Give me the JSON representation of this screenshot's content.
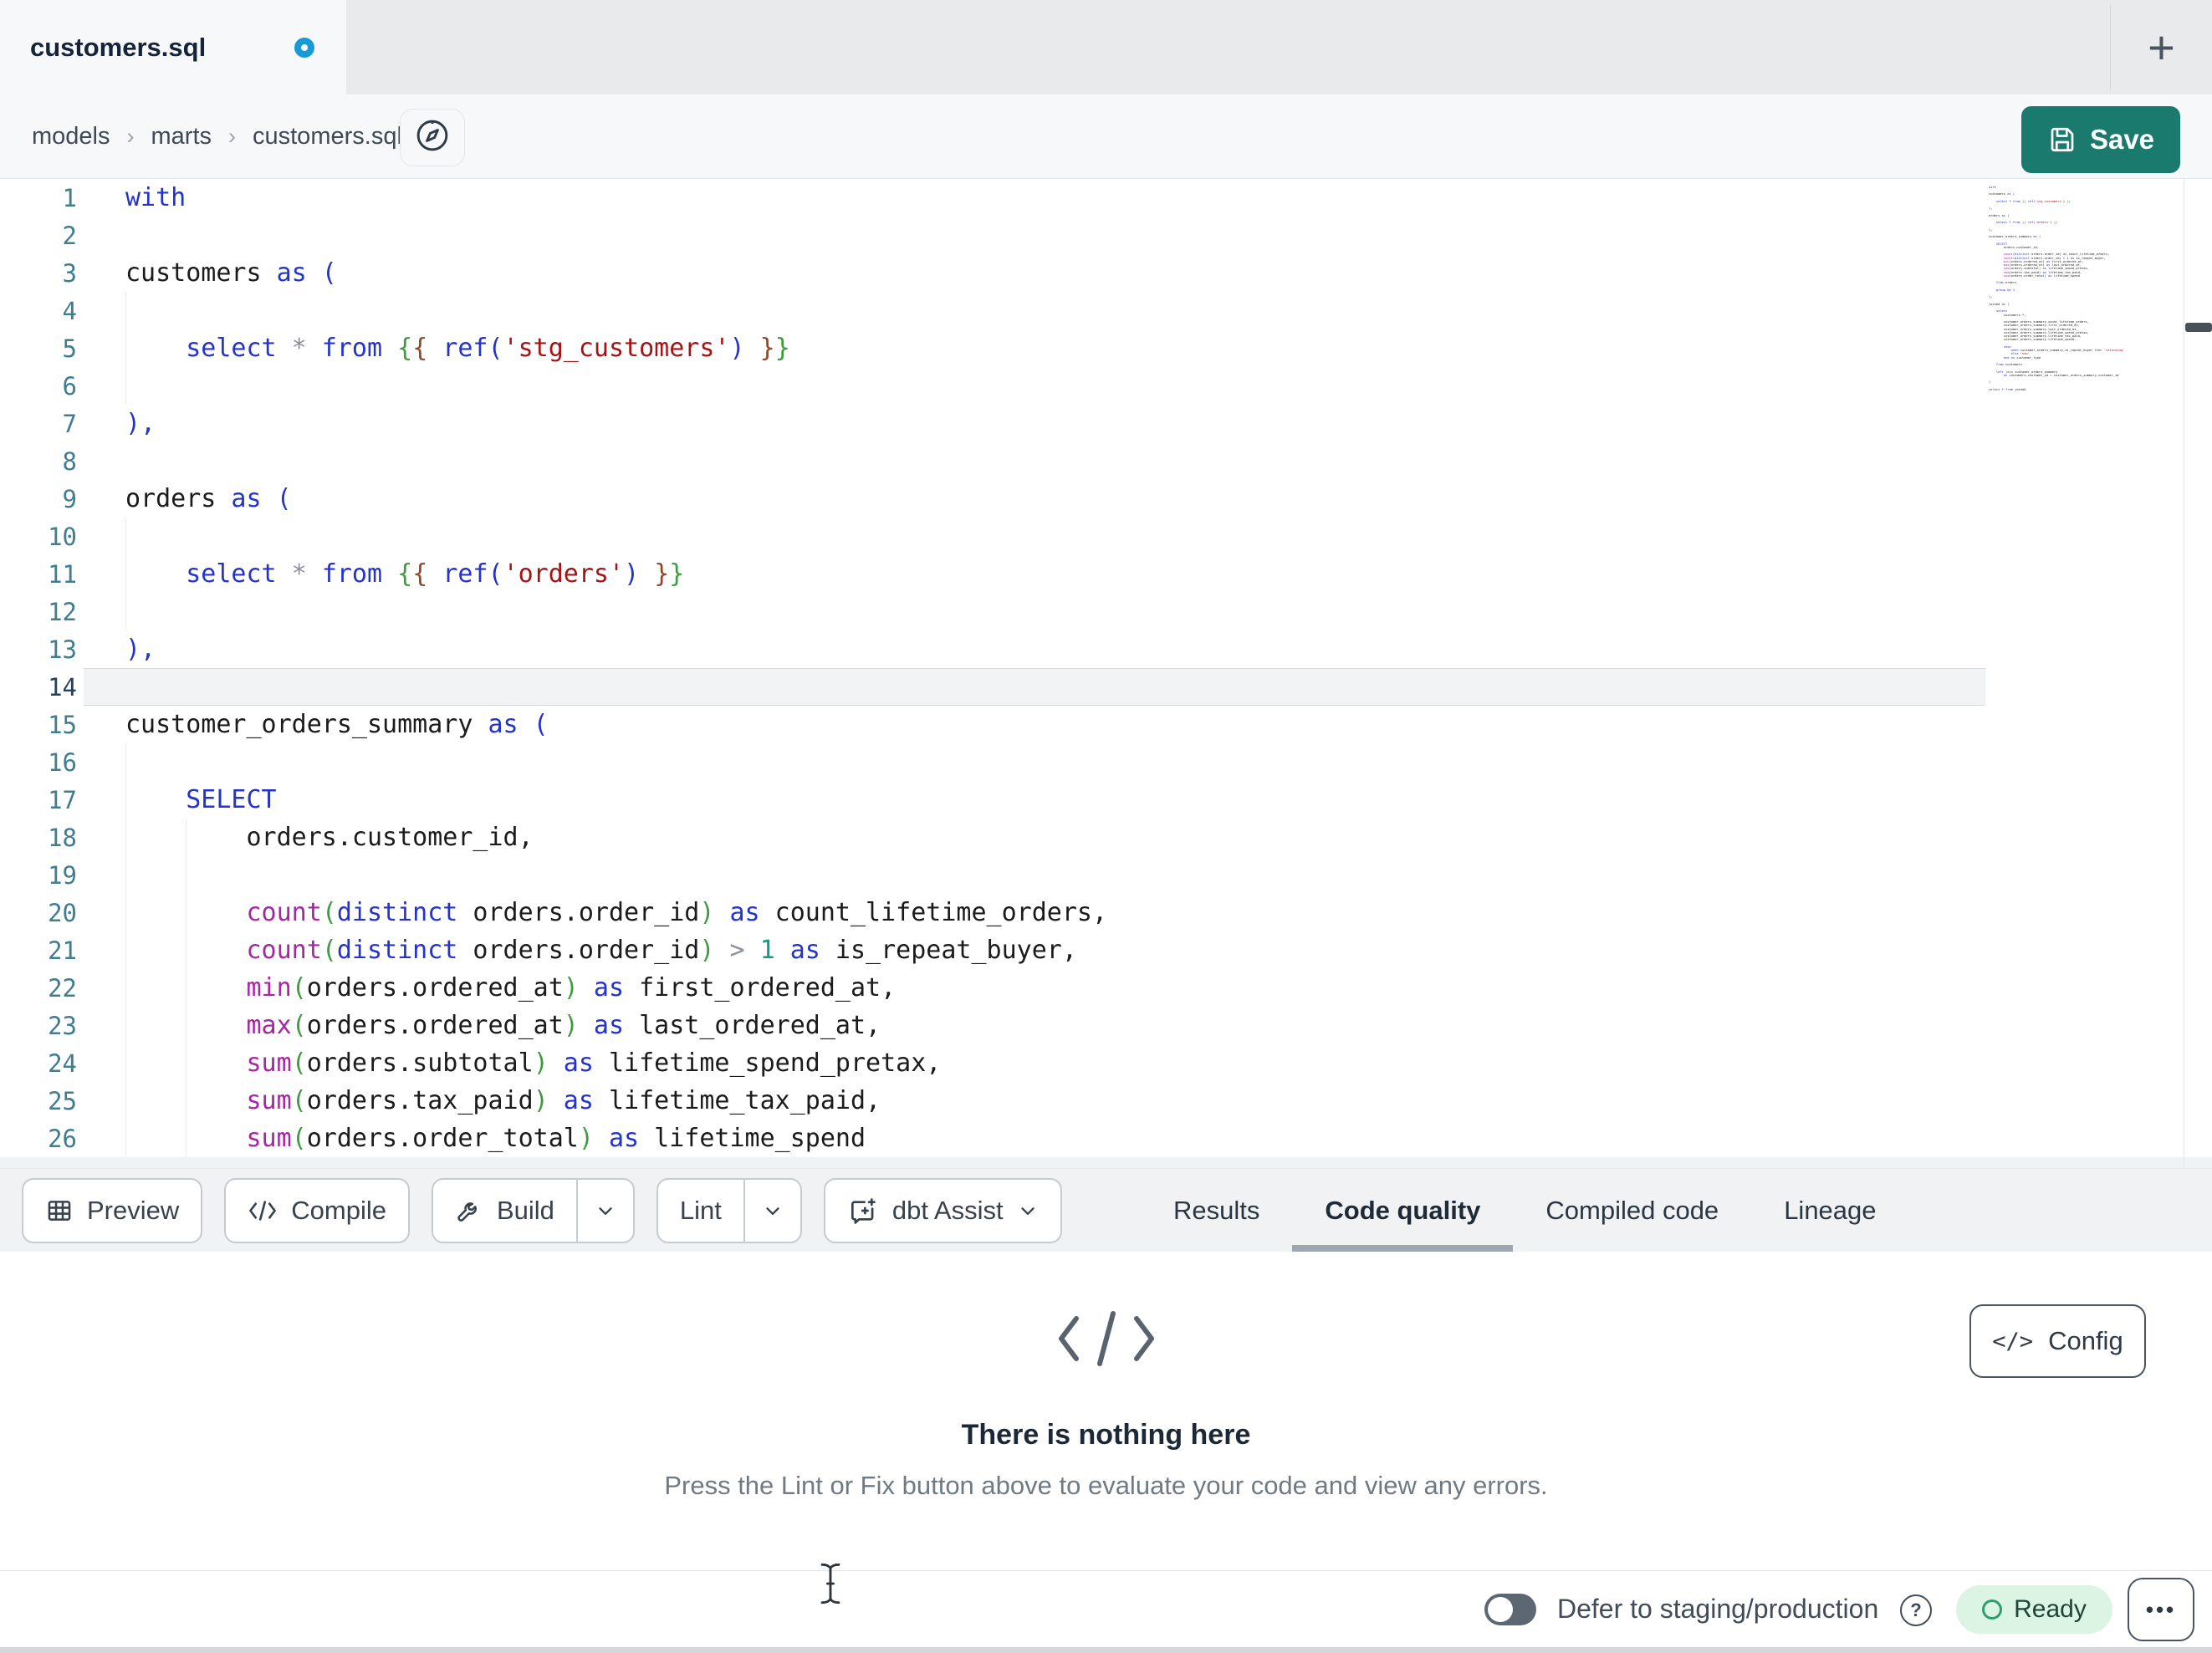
{
  "tab_bar": {
    "tab_label": "customers.sql",
    "modified": true,
    "new_tab_button": "+"
  },
  "breadcrumb": {
    "items": [
      "models",
      "marts",
      "customers.sql"
    ],
    "separator": "›"
  },
  "header": {
    "save_label": "Save"
  },
  "editor": {
    "active_line": 14,
    "lines": [
      {
        "n": 1,
        "guides": [],
        "tokens": [
          [
            "kw",
            "with"
          ]
        ]
      },
      {
        "n": 2,
        "guides": [],
        "tokens": []
      },
      {
        "n": 3,
        "guides": [],
        "tokens": [
          [
            "id",
            "customers"
          ],
          [
            "kw",
            " as ("
          ]
        ]
      },
      {
        "n": 4,
        "guides": [
          0
        ],
        "tokens": []
      },
      {
        "n": 5,
        "guides": [
          0
        ],
        "tokens": [
          [
            "ws",
            "    "
          ],
          [
            "kw",
            "select"
          ],
          [
            "op",
            " * "
          ],
          [
            "kw",
            "from "
          ],
          [
            "jg",
            "{"
          ],
          [
            "jb",
            "{"
          ],
          [
            "ws",
            " "
          ],
          [
            "kw",
            "ref("
          ],
          [
            "str",
            "'stg_customers'"
          ],
          [
            "kw",
            ")"
          ],
          [
            "ws",
            " "
          ],
          [
            "jb",
            "}"
          ],
          [
            "jg",
            "}"
          ]
        ]
      },
      {
        "n": 6,
        "guides": [
          0
        ],
        "tokens": []
      },
      {
        "n": 7,
        "guides": [],
        "tokens": [
          [
            "kw",
            "),"
          ]
        ]
      },
      {
        "n": 8,
        "guides": [],
        "tokens": []
      },
      {
        "n": 9,
        "guides": [],
        "tokens": [
          [
            "id",
            "orders"
          ],
          [
            "kw",
            " as ("
          ]
        ]
      },
      {
        "n": 10,
        "guides": [
          0
        ],
        "tokens": []
      },
      {
        "n": 11,
        "guides": [
          0
        ],
        "tokens": [
          [
            "ws",
            "    "
          ],
          [
            "kw",
            "select"
          ],
          [
            "op",
            " * "
          ],
          [
            "kw",
            "from "
          ],
          [
            "jg",
            "{"
          ],
          [
            "jb",
            "{"
          ],
          [
            "ws",
            " "
          ],
          [
            "kw",
            "ref("
          ],
          [
            "str",
            "'orders'"
          ],
          [
            "kw",
            ")"
          ],
          [
            "ws",
            " "
          ],
          [
            "jb",
            "}"
          ],
          [
            "jg",
            "}"
          ]
        ]
      },
      {
        "n": 12,
        "guides": [
          0
        ],
        "tokens": []
      },
      {
        "n": 13,
        "guides": [],
        "tokens": [
          [
            "kw",
            "),"
          ]
        ]
      },
      {
        "n": 14,
        "guides": [],
        "tokens": []
      },
      {
        "n": 15,
        "guides": [],
        "tokens": [
          [
            "id",
            "customer_orders_summary"
          ],
          [
            "kw",
            " as ("
          ]
        ]
      },
      {
        "n": 16,
        "guides": [
          0
        ],
        "tokens": []
      },
      {
        "n": 17,
        "guides": [
          0
        ],
        "tokens": [
          [
            "ws",
            "    "
          ],
          [
            "kw",
            "SELECT"
          ]
        ]
      },
      {
        "n": 18,
        "guides": [
          0,
          1
        ],
        "tokens": [
          [
            "ws",
            "        "
          ],
          [
            "id",
            "orders.customer_id,"
          ]
        ]
      },
      {
        "n": 19,
        "guides": [
          0,
          1
        ],
        "tokens": []
      },
      {
        "n": 20,
        "guides": [
          0,
          1
        ],
        "tokens": [
          [
            "ws",
            "        "
          ],
          [
            "fn",
            "count"
          ],
          [
            "pg",
            "("
          ],
          [
            "kw",
            "distinct"
          ],
          [
            "id",
            " orders.order_id"
          ],
          [
            "pg",
            ")"
          ],
          [
            "kw",
            " as"
          ],
          [
            "id",
            " count_lifetime_orders,"
          ]
        ]
      },
      {
        "n": 21,
        "guides": [
          0,
          1
        ],
        "tokens": [
          [
            "ws",
            "        "
          ],
          [
            "fn",
            "count"
          ],
          [
            "pg",
            "("
          ],
          [
            "kw",
            "distinct"
          ],
          [
            "id",
            " orders.order_id"
          ],
          [
            "pg",
            ")"
          ],
          [
            "op",
            " > "
          ],
          [
            "num",
            "1"
          ],
          [
            "kw",
            " as"
          ],
          [
            "id",
            " is_repeat_buyer,"
          ]
        ]
      },
      {
        "n": 22,
        "guides": [
          0,
          1
        ],
        "tokens": [
          [
            "ws",
            "        "
          ],
          [
            "fn",
            "min"
          ],
          [
            "pg",
            "("
          ],
          [
            "id",
            "orders.ordered_at"
          ],
          [
            "pg",
            ")"
          ],
          [
            "kw",
            " as"
          ],
          [
            "id",
            " first_ordered_at,"
          ]
        ]
      },
      {
        "n": 23,
        "guides": [
          0,
          1
        ],
        "tokens": [
          [
            "ws",
            "        "
          ],
          [
            "fn",
            "max"
          ],
          [
            "pg",
            "("
          ],
          [
            "id",
            "orders.ordered_at"
          ],
          [
            "pg",
            ")"
          ],
          [
            "kw",
            " as"
          ],
          [
            "id",
            " last_ordered_at,"
          ]
        ]
      },
      {
        "n": 24,
        "guides": [
          0,
          1
        ],
        "tokens": [
          [
            "ws",
            "        "
          ],
          [
            "fn",
            "sum"
          ],
          [
            "pg",
            "("
          ],
          [
            "id",
            "orders.subtotal"
          ],
          [
            "pg",
            ")"
          ],
          [
            "kw",
            " as"
          ],
          [
            "id",
            " lifetime_spend_pretax,"
          ]
        ]
      },
      {
        "n": 25,
        "guides": [
          0,
          1
        ],
        "tokens": [
          [
            "ws",
            "        "
          ],
          [
            "fn",
            "sum"
          ],
          [
            "pg",
            "("
          ],
          [
            "id",
            "orders.tax_paid"
          ],
          [
            "pg",
            ")"
          ],
          [
            "kw",
            " as"
          ],
          [
            "id",
            " lifetime_tax_paid,"
          ]
        ]
      },
      {
        "n": 26,
        "guides": [
          0,
          1
        ],
        "tokens": [
          [
            "ws",
            "        "
          ],
          [
            "fn",
            "sum"
          ],
          [
            "pg",
            "("
          ],
          [
            "id",
            "orders.order_total"
          ],
          [
            "pg",
            ")"
          ],
          [
            "kw",
            " as"
          ],
          [
            "id",
            " lifetime_spend"
          ]
        ]
      }
    ],
    "minimap_lines": [
      "with",
      "",
      "customers as (",
      "",
      "    select * from {{ ref('stg_customers') }}",
      "",
      "),",
      "",
      "orders as (",
      "",
      "    select * from {{ ref('orders') }}",
      "",
      "),",
      "",
      "customer_orders_summary as (",
      "",
      "    SELECT",
      "        orders.customer_id,",
      "",
      "        count(distinct orders.order_id) as count_lifetime_orders,",
      "        count(distinct orders.order_id) > 1 as is_repeat_buyer,",
      "        min(orders.ordered_at) as first_ordered_at,",
      "        max(orders.ordered_at) as last_ordered_at,",
      "        sum(orders.subtotal) as lifetime_spend_pretax,",
      "        sum(orders.tax_paid) as lifetime_tax_paid,",
      "        sum(orders.order_total) as lifetime_spend",
      "",
      "    from orders",
      "",
      "    group by 1",
      "",
      "),",
      "",
      "joined as (",
      "",
      "    select",
      "        customers.*,",
      "",
      "        customer_orders_summary.count_lifetime_orders,",
      "        customer_orders_summary.first_ordered_at,",
      "        customer_orders_summary.last_ordered_at,",
      "        customer_orders_summary.lifetime_spend_pretax,",
      "        customer_orders_summary.lifetime_tax_paid,",
      "        customer_orders_summary.lifetime_spend,",
      "",
      "        case",
      "            when customer_orders_summary.is_repeat_buyer then 'returning'",
      "            else 'new'",
      "        end as customer_type",
      "",
      "    from customers",
      "",
      "    left join customer_orders_summary",
      "        on customers.customer_id = customer_orders_summary.customer_id",
      "",
      ")",
      "",
      "select * from joined"
    ]
  },
  "toolbar": {
    "buttons": [
      {
        "id": "preview",
        "label": "Preview",
        "icon": "table-icon",
        "split": false,
        "chevron": false
      },
      {
        "id": "compile",
        "label": "Compile",
        "icon": "code-icon",
        "split": false,
        "chevron": false
      },
      {
        "id": "build",
        "label": "Build",
        "icon": "wrench-icon",
        "split": true,
        "chevron": true
      },
      {
        "id": "lint",
        "label": "Lint",
        "icon": null,
        "split": true,
        "chevron": true
      },
      {
        "id": "dbt-assist",
        "label": "dbt Assist",
        "icon": "assist-icon",
        "split": false,
        "chevron": true
      }
    ]
  },
  "panel_tabs": {
    "items": [
      {
        "label": "Results",
        "active": false
      },
      {
        "label": "Code quality",
        "active": true
      },
      {
        "label": "Compiled code",
        "active": false
      },
      {
        "label": "Lineage",
        "active": false
      }
    ]
  },
  "results_panel": {
    "title": "There is nothing here",
    "subtitle": "Press the Lint or Fix button above to evaluate your code and view any errors.",
    "config_label": "Config",
    "config_glyph": "</>"
  },
  "status_bar": {
    "defer_label": "Defer to staging/production",
    "defer_toggle_on": false,
    "help_glyph": "?",
    "ready_label": "Ready",
    "more_label": "•••"
  },
  "colors": {
    "accent_teal": "#1b7a6e",
    "modified_dot": "#189ad6",
    "tab_underline": "#9ea6b0",
    "ready_bg": "#dcf4e3",
    "ready_text": "#1d4438",
    "syntax": {
      "kw": "#2433cc",
      "id": "#1b1b1b",
      "fn": "#a626a4",
      "pg": "#3f9b3f",
      "jg": "#3f9b3f",
      "jb": "#8b4a2b",
      "str": "#a31515",
      "op": "#8a919a",
      "num": "#16997f",
      "ws": "#1b1b1b",
      "line_number": "#3f7e90",
      "line_number_active": "#24435c"
    }
  }
}
